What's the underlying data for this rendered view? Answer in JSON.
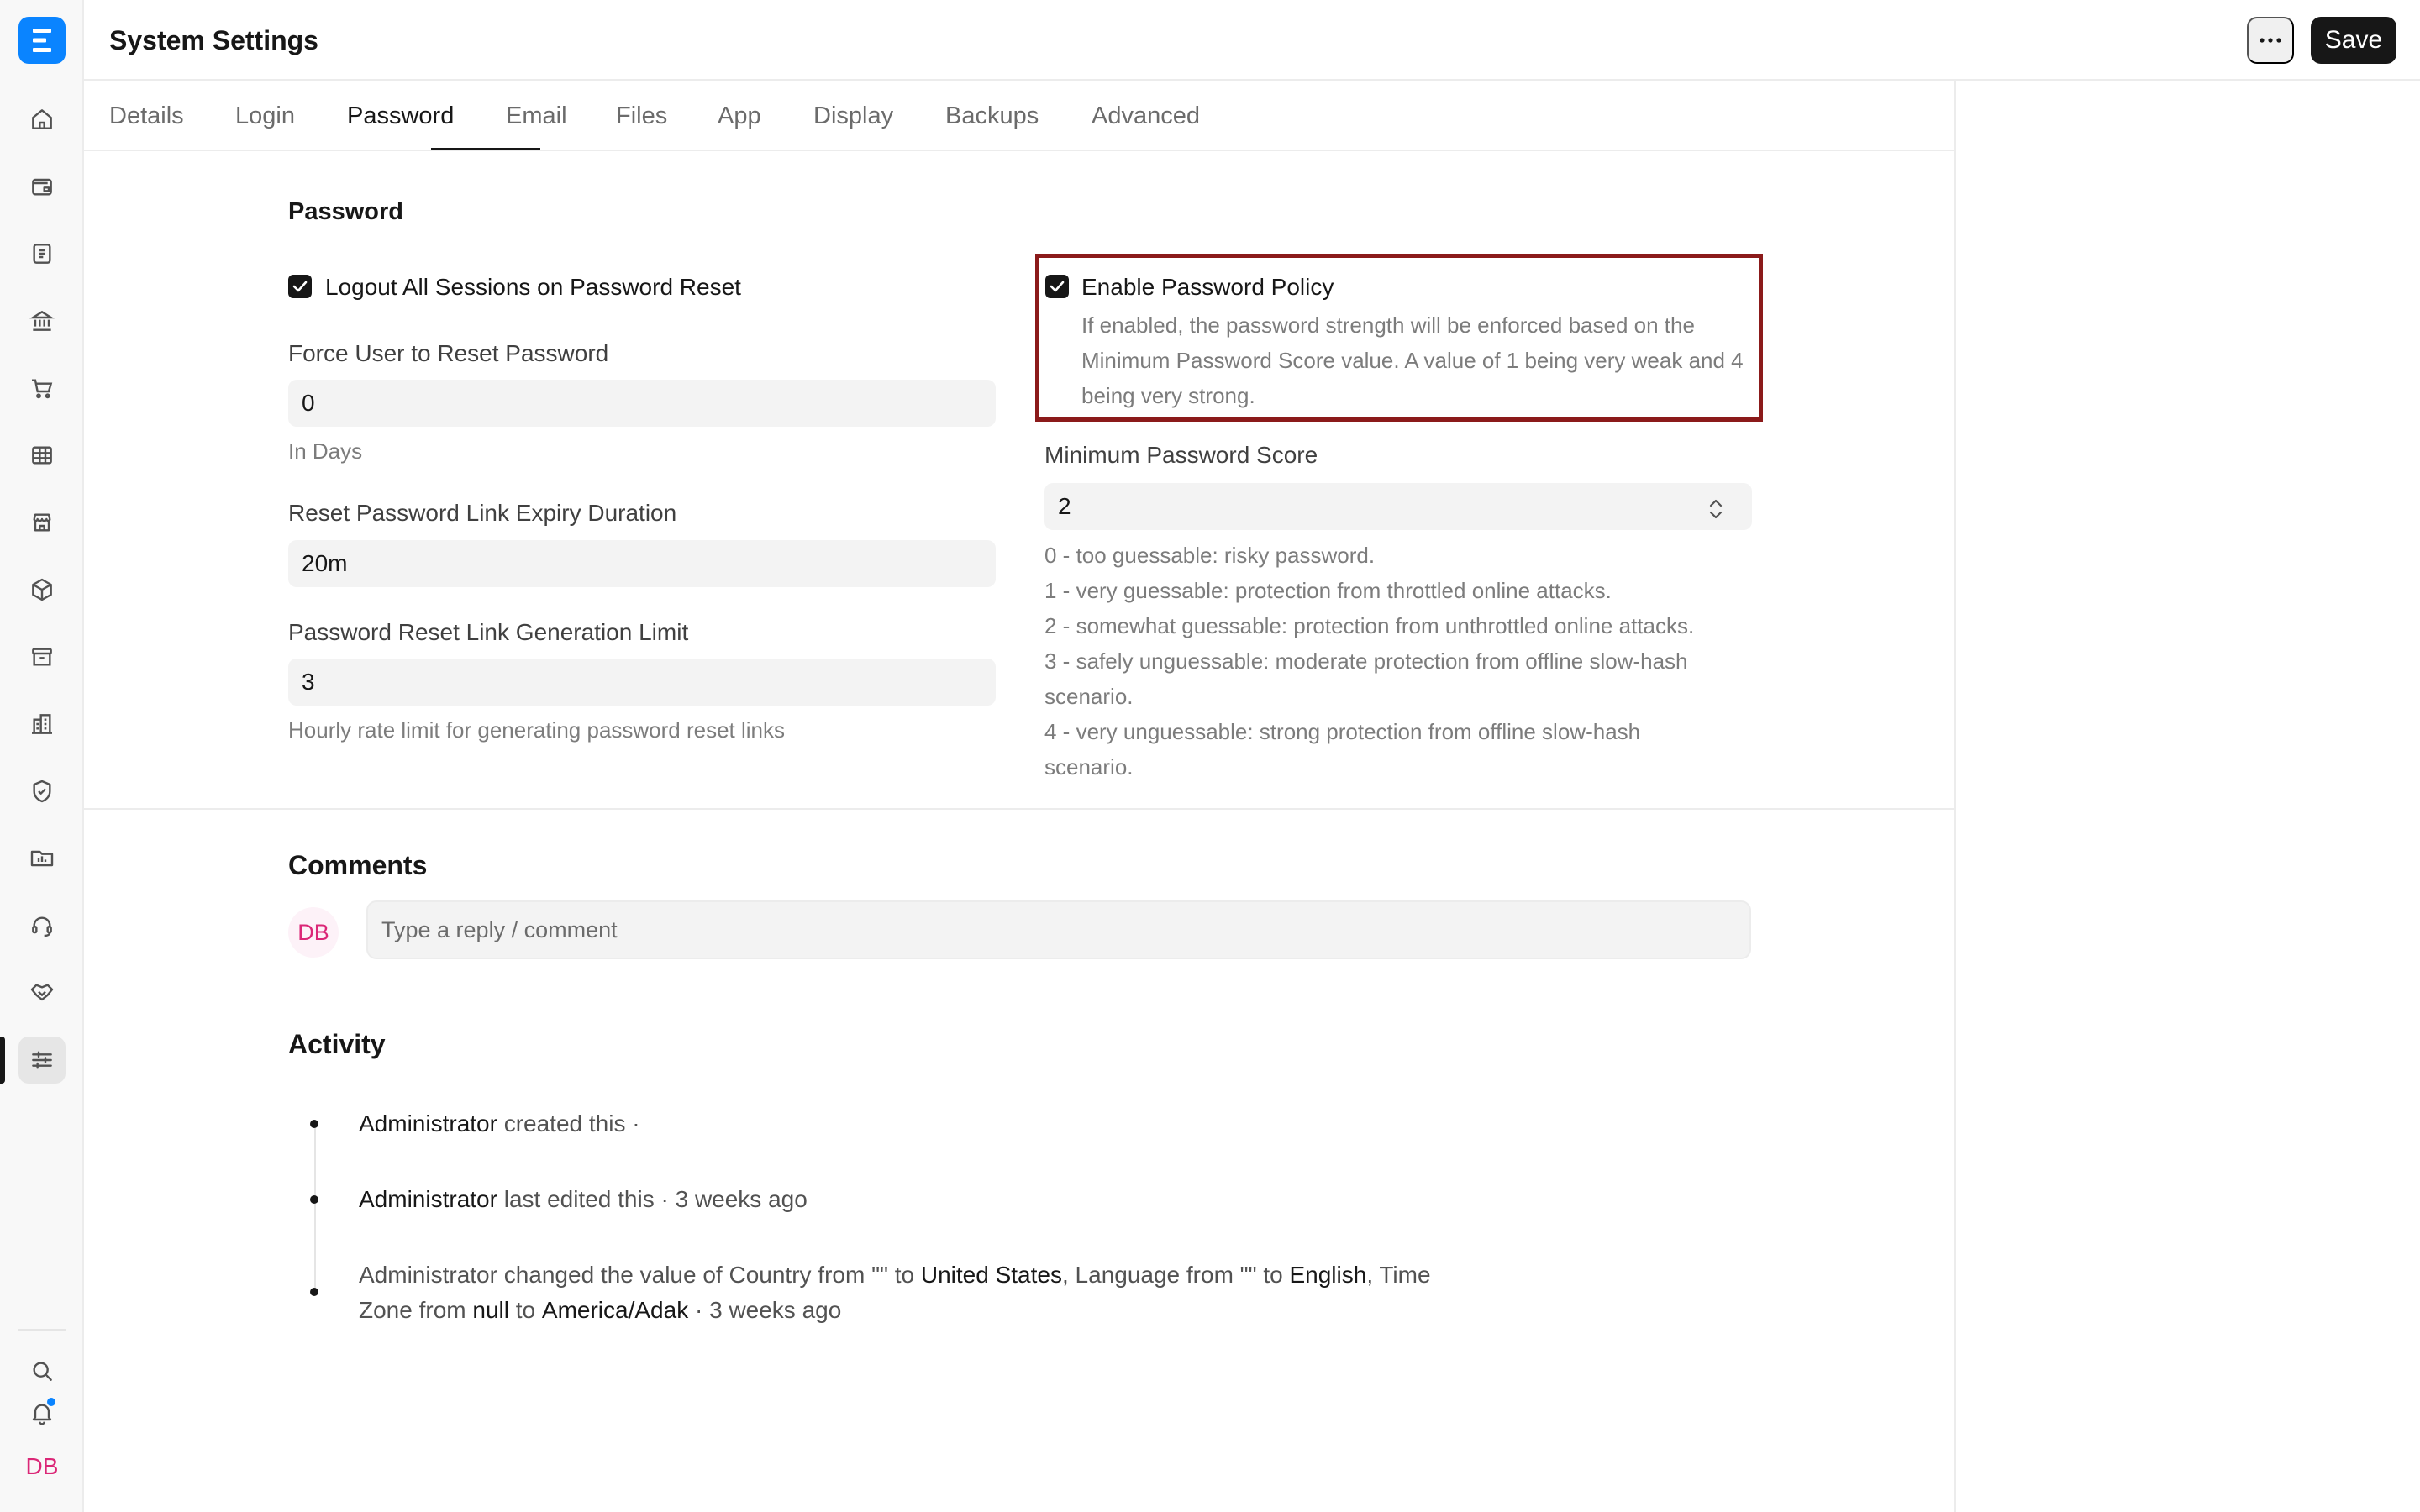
{
  "header": {
    "title": "System Settings",
    "save_label": "Save"
  },
  "sidebar": {
    "logo_letter": "E",
    "items": [
      {
        "icon": "home-icon"
      },
      {
        "icon": "wallet-icon"
      },
      {
        "icon": "document-icon"
      },
      {
        "icon": "bank-icon"
      },
      {
        "icon": "cart-icon"
      },
      {
        "icon": "table-icon"
      },
      {
        "icon": "store-icon"
      },
      {
        "icon": "package-icon"
      },
      {
        "icon": "archive-icon"
      },
      {
        "icon": "building-icon"
      },
      {
        "icon": "shield-icon"
      },
      {
        "icon": "folder-chart-icon"
      },
      {
        "icon": "headset-icon"
      },
      {
        "icon": "handshake-icon"
      },
      {
        "icon": "sliders-icon",
        "active": true
      }
    ],
    "bottom": {
      "search_icon": "search-icon",
      "bell_icon": "bell-icon",
      "avatar": "DB"
    }
  },
  "tabs": [
    "Details",
    "Login",
    "Password",
    "Email",
    "Files",
    "App",
    "Display",
    "Backups",
    "Advanced"
  ],
  "active_tab": "Password",
  "password_section": {
    "title": "Password",
    "logout_all": {
      "label": "Logout All Sessions on Password Reset",
      "checked": true
    },
    "force_reset": {
      "label": "Force User to Reset Password",
      "value": "0",
      "help": "In Days"
    },
    "expiry": {
      "label": "Reset Password Link Expiry Duration",
      "value": "20m"
    },
    "gen_limit": {
      "label": "Password Reset Link Generation Limit",
      "value": "3",
      "help": "Hourly rate limit for generating password reset links"
    },
    "policy": {
      "label": "Enable Password Policy",
      "checked": true,
      "description": "If enabled, the password strength will be enforced based on the Minimum Password Score value. A value of 1 being very weak and 4 being very strong."
    },
    "min_score": {
      "label": "Minimum Password Score",
      "value": "2",
      "help": [
        "0 - too guessable: risky password.",
        "1 - very guessable: protection from throttled online attacks.",
        "2 - somewhat guessable: protection from unthrottled online attacks.",
        "3 - safely unguessable: moderate protection from offline slow-hash",
        "scenario.",
        "4 - very unguessable: strong protection from offline slow-hash",
        "scenario."
      ]
    }
  },
  "comments": {
    "title": "Comments",
    "avatar": "DB",
    "placeholder": "Type a reply / comment"
  },
  "activity": {
    "title": "Activity",
    "items": [
      {
        "who": "Administrator",
        "text": " created this ·"
      },
      {
        "who": "Administrator",
        "text": " last edited this · 3 weeks ago"
      },
      {
        "line1_a": "Administrator changed the value of Country from \"\" to ",
        "v1": "United States",
        "line1_b": ", Language from \"\" to ",
        "v2": "English",
        "line1_c": ", Time",
        "line2_a": "Zone from ",
        "v3": "null",
        "line2_b": " to ",
        "v4": "America/Adak",
        "line2_c": " · 3 weeks ago"
      }
    ]
  }
}
